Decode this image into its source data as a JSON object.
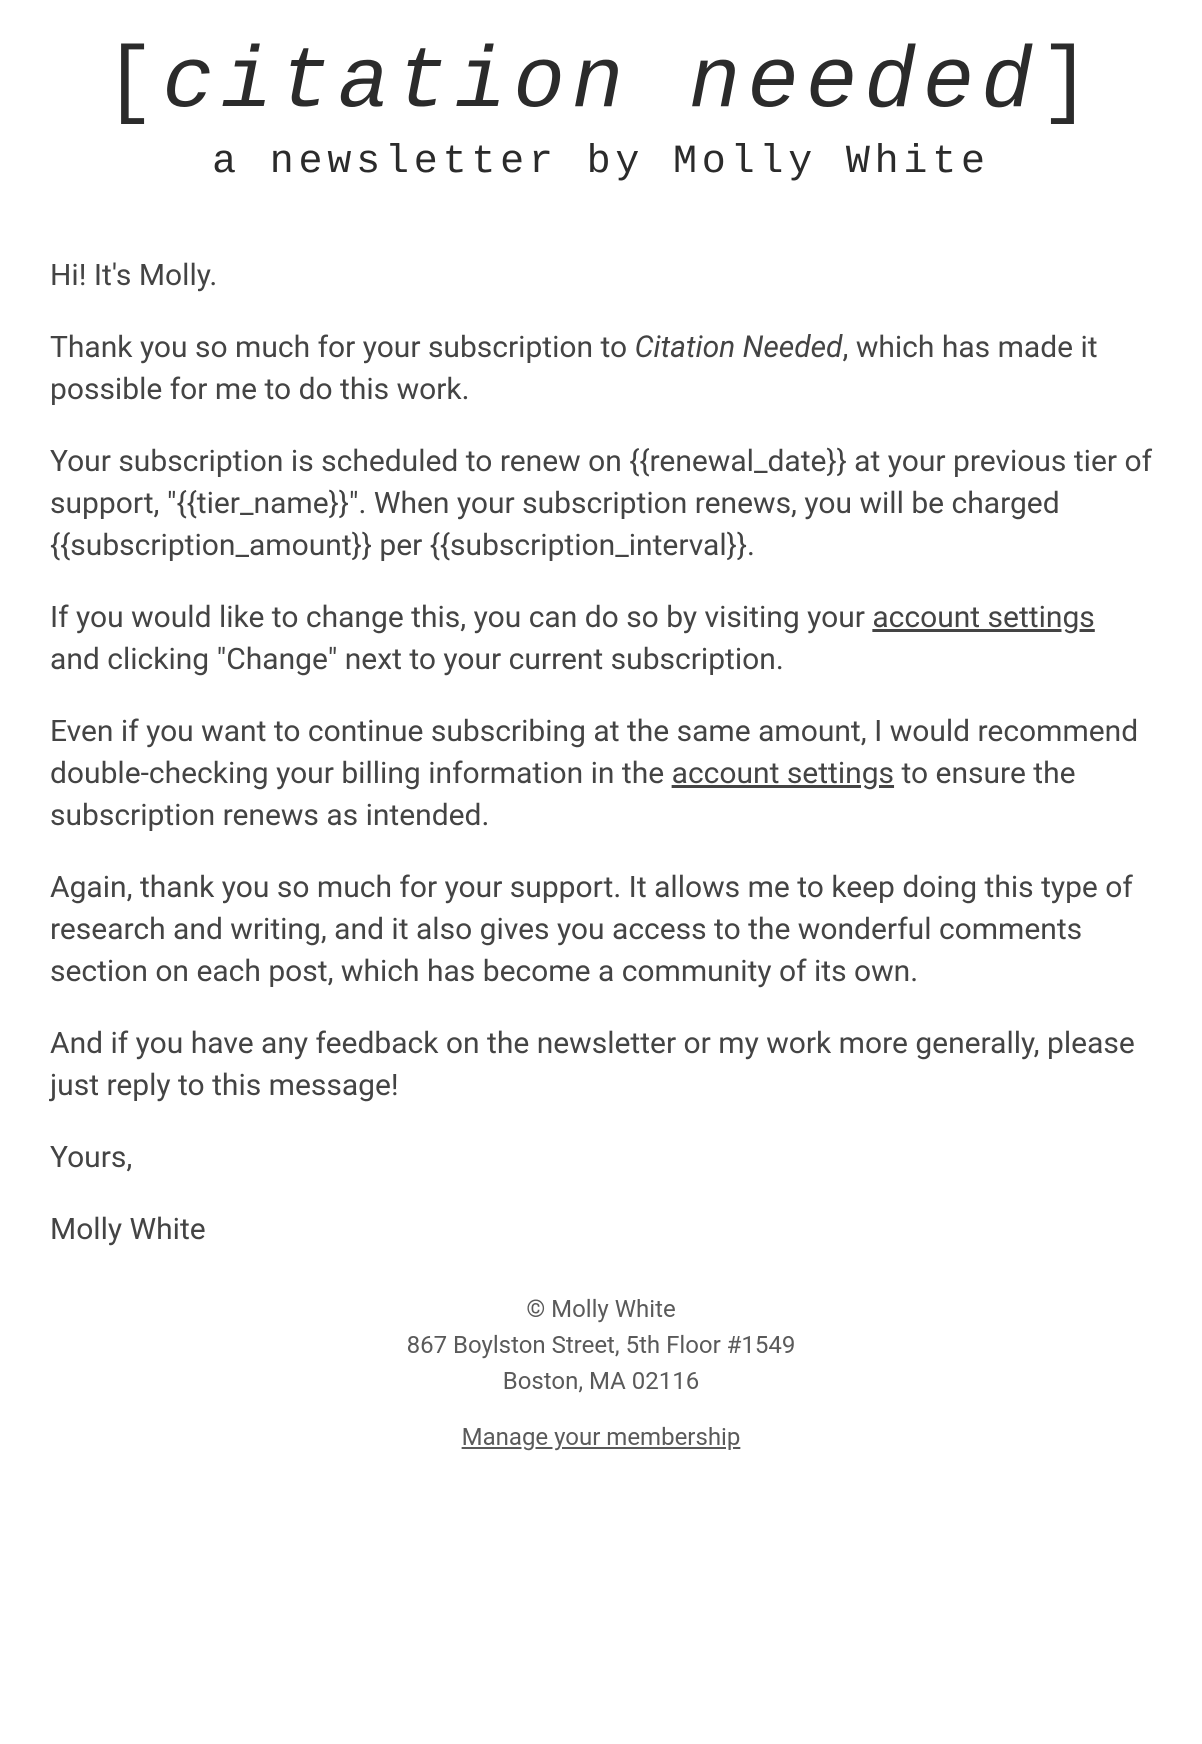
{
  "header": {
    "title_inner": "citation needed",
    "subtitle": "a newsletter by Molly White"
  },
  "body": {
    "greeting": "Hi! It's Molly.",
    "p1_pre": "Thank you so much for your subscription to ",
    "p1_italic": "Citation Needed",
    "p1_post": ", which has made it possible for me to do this work.",
    "p2": "Your subscription is scheduled to renew on {{renewal_date}} at your previous tier of support, \"{{tier_name}}\". When your subscription renews, you will be charged {{subscription_amount}} per {{subscription_interval}}.",
    "p3_pre": "If you would like to change this, you can do so by visiting your ",
    "p3_link": "account settings",
    "p3_post": " and clicking \"Change\" next to your current subscription.",
    "p4_pre": "Even if you want to continue subscribing at the same amount, I would recommend double-checking your billing information in the ",
    "p4_link": "account settings",
    "p4_post": " to ensure the subscription renews as intended.",
    "p5": "Again, thank you so much for your support. It allows me to keep doing this type of research and writing, and it also gives you access to the wonderful comments section on each post, which has become a community of its own.",
    "p6": "And if you have any feedback on the newsletter or my work more generally, please just reply to this message!",
    "signoff_yours": "Yours,",
    "signoff_name": "Molly White"
  },
  "footer": {
    "copyright": "© Molly White",
    "address_line1": "867 Boylston Street, 5th Floor #1549",
    "address_line2": "Boston, MA 02116",
    "manage_link": "Manage your membership"
  }
}
